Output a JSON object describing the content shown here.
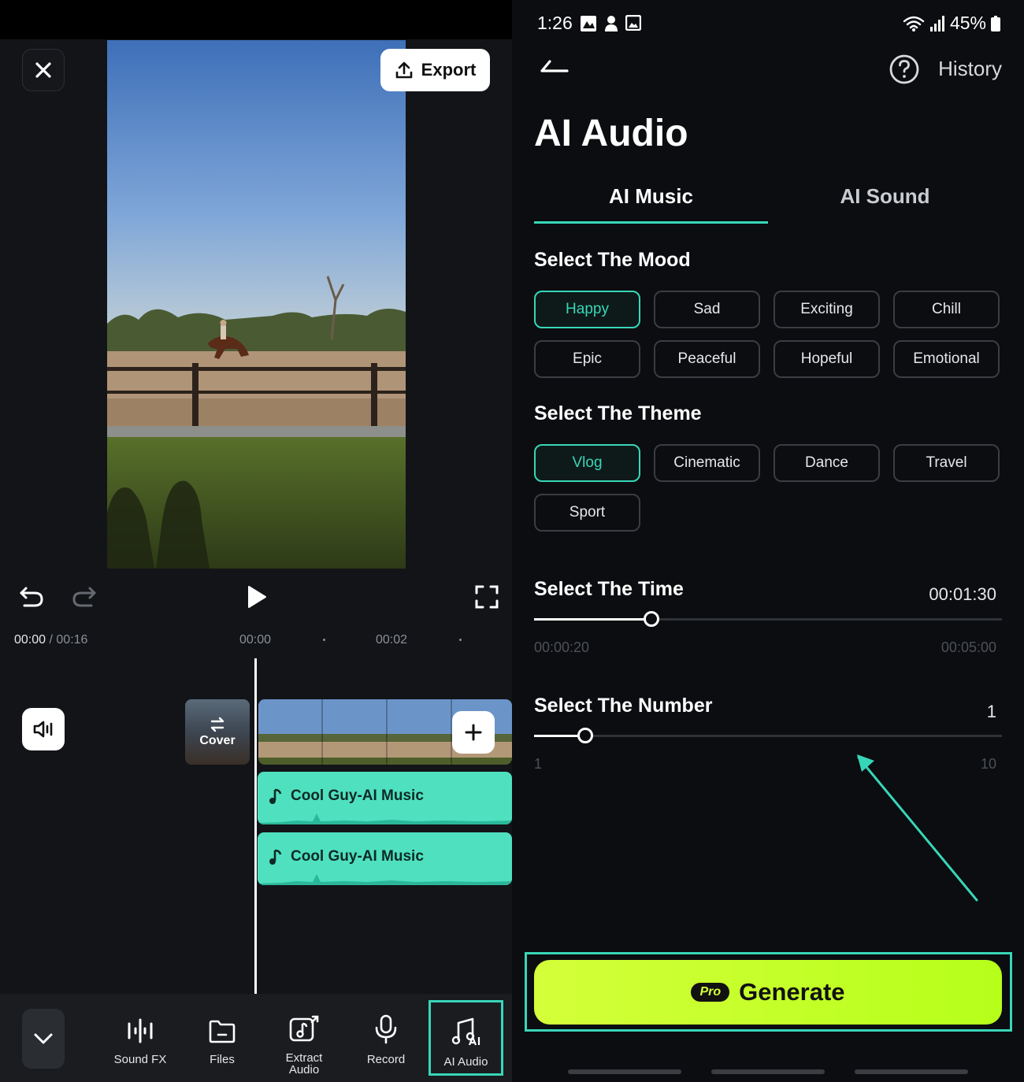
{
  "editor": {
    "export_label": "Export",
    "time_current": "00:00",
    "time_separator": " / ",
    "time_total": "00:16",
    "ruler_labels": [
      "00:00",
      "00:02"
    ],
    "cover_label": "Cover",
    "tracks": [
      {
        "label": "Cool Guy-AI Music"
      },
      {
        "label": "Cool Guy-AI Music"
      }
    ],
    "toolbar": [
      {
        "label": "Sound FX",
        "icon": "sound-fx-icon"
      },
      {
        "label": "Files",
        "icon": "folder-icon"
      },
      {
        "label": "Extract Audio",
        "icon": "extract-audio-icon"
      },
      {
        "label": "Record",
        "icon": "microphone-icon"
      },
      {
        "label": "AI Audio",
        "icon": "ai-audio-icon",
        "active": true
      }
    ]
  },
  "status_bar": {
    "time": "1:26",
    "battery": "45%"
  },
  "ai_audio": {
    "history_label": "History",
    "title": "AI Audio",
    "tabs": [
      {
        "label": "AI Music",
        "active": true
      },
      {
        "label": "AI Sound",
        "active": false
      }
    ],
    "mood": {
      "title": "Select The Mood",
      "selected": "Happy",
      "options": [
        "Happy",
        "Sad",
        "Exciting",
        "Chill",
        "Epic",
        "Peaceful",
        "Hopeful",
        "Emotional"
      ]
    },
    "theme": {
      "title": "Select The Theme",
      "selected": "Vlog",
      "options": [
        "Vlog",
        "Cinematic",
        "Dance",
        "Travel",
        "Sport"
      ]
    },
    "time": {
      "title": "Select The Time",
      "value": "00:01:30",
      "min_label": "00:00:20",
      "max_label": "00:05:00",
      "fraction": 0.25
    },
    "number": {
      "title": "Select The Number",
      "value": "1",
      "min_label": "1",
      "max_label": "10",
      "fraction": 0.11
    },
    "generate": {
      "badge": "Pro",
      "label": "Generate"
    }
  },
  "colors": {
    "accent": "#38d6b8",
    "generate": "#c8ff2a",
    "track": "#4fe0c0"
  }
}
